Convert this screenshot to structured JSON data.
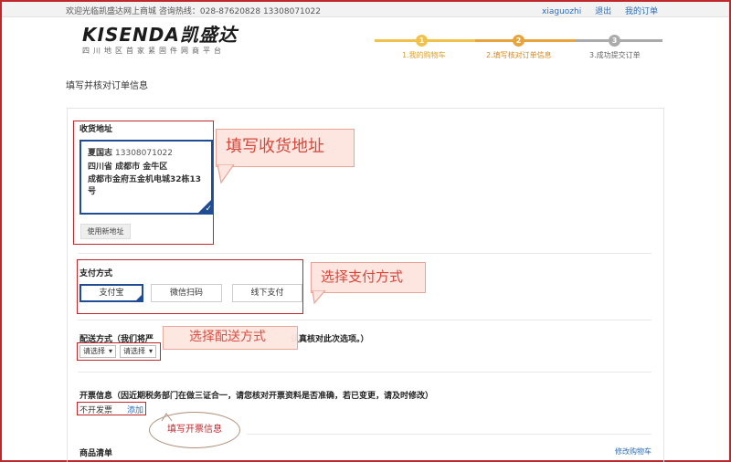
{
  "topbar": {
    "welcome": "欢迎光临凯盛达网上商城 咨询热线：028-87620828 13308071022",
    "username": "xiaguozhi",
    "logout": "退出",
    "my_orders": "我的订单"
  },
  "logo": {
    "text": "KISENDA凯盛达",
    "subtitle": "四川地区首家紧固件网商平台"
  },
  "steps": [
    {
      "num": "1",
      "label": "1.我的购物车"
    },
    {
      "num": "2",
      "label": "2.填写核对订单信息"
    },
    {
      "num": "3",
      "label": "3.成功提交订单"
    }
  ],
  "page_title": "填写并核对订单信息",
  "address": {
    "heading": "收货地址",
    "name": "夏国志",
    "phone": "13308071022",
    "line1": "四川省 成都市 金牛区",
    "line2": "成都市金府五金机电城32栋13号",
    "new_button": "使用新地址",
    "callout": "填写收货地址"
  },
  "payment": {
    "heading": "支付方式",
    "options": [
      "支付宝",
      "微信扫码",
      "线下支付"
    ],
    "callout": "选择支付方式"
  },
  "delivery": {
    "heading_start": "配送方式（我们将严",
    "heading_end": "认真核对此次选项。）",
    "select1": "请选择",
    "select2": "请选择",
    "callout": "选择配送方式"
  },
  "invoice": {
    "heading": "开票信息（因近期税务部门在做三证合一，请您核对开票资料是否准确，若已变更，请及时修改）",
    "value": "不开发票",
    "add": "添加",
    "callout": "填写开票信息"
  },
  "goods": {
    "heading": "商品清单",
    "modify_cart": "修改购物车"
  },
  "colors": {
    "accent_red": "#c0272d",
    "step_done": "#f0c24b",
    "step_current": "#e8a33b",
    "step_todo": "#aaaaaa",
    "selected_blue": "#1f4c93"
  }
}
